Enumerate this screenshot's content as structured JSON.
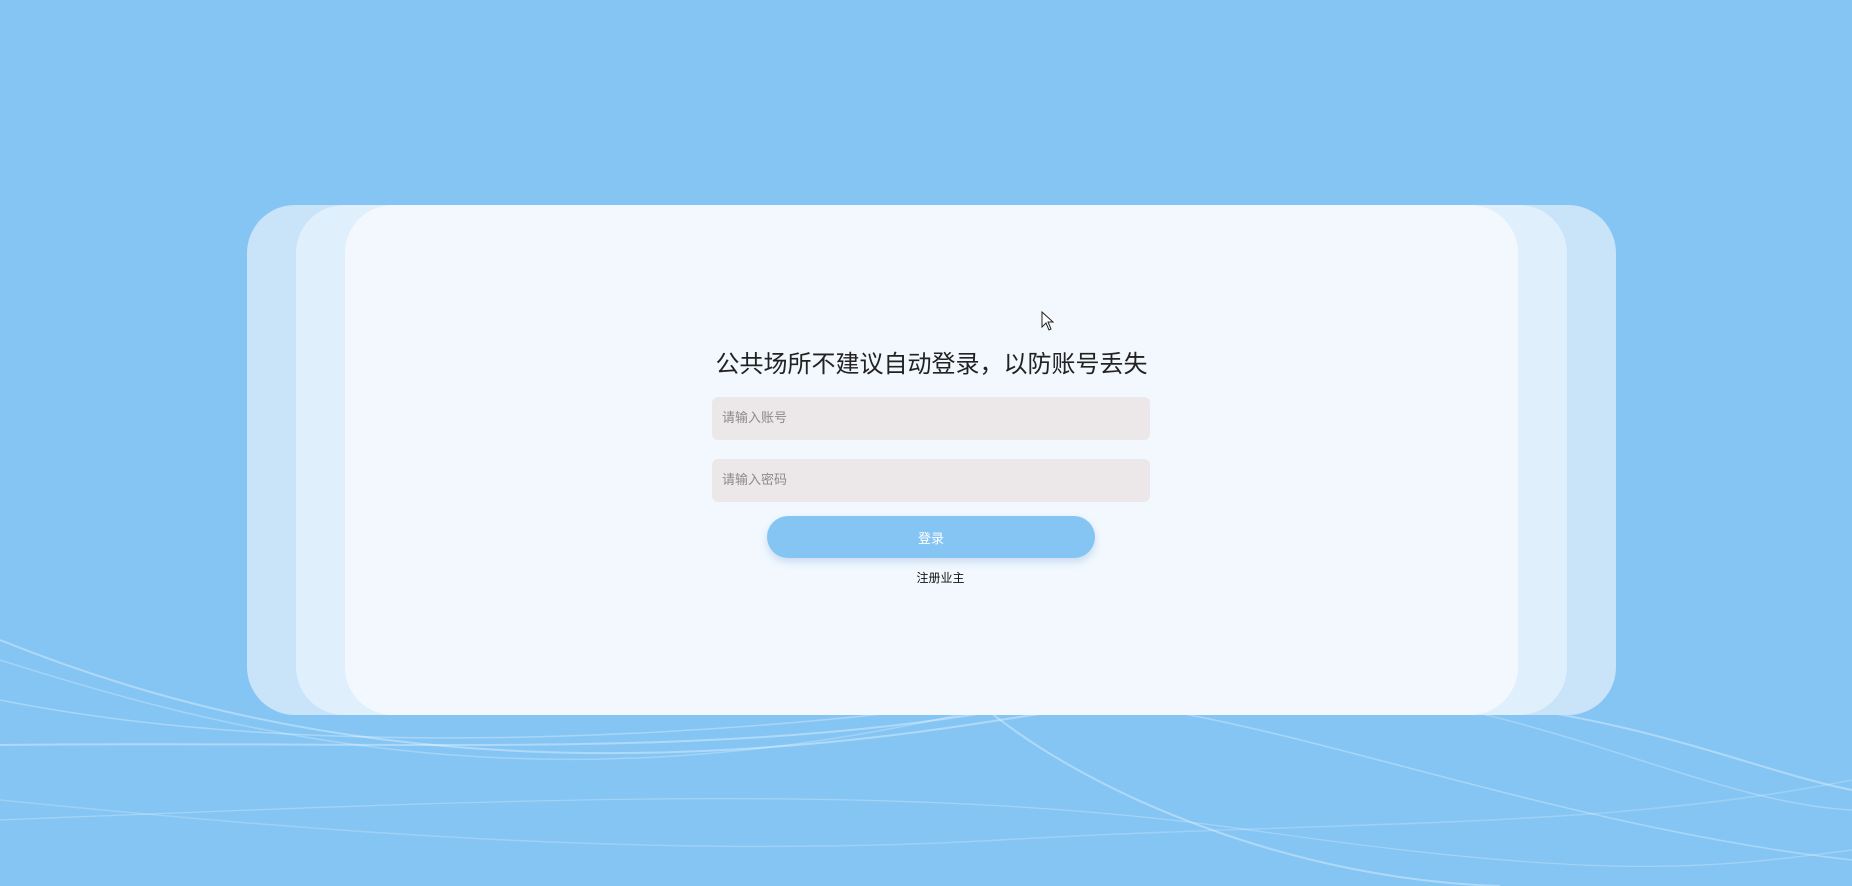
{
  "login": {
    "title": "公共场所不建议自动登录，以防账号丢失",
    "account_placeholder": "请输入账号",
    "password_placeholder": "请输入密码",
    "login_button": "登录",
    "register_link": "注册业主"
  },
  "colors": {
    "background": "#85c5f4",
    "button": "#85c5f4",
    "input_bg": "#ece8ea",
    "card": "#f2f8fe"
  }
}
